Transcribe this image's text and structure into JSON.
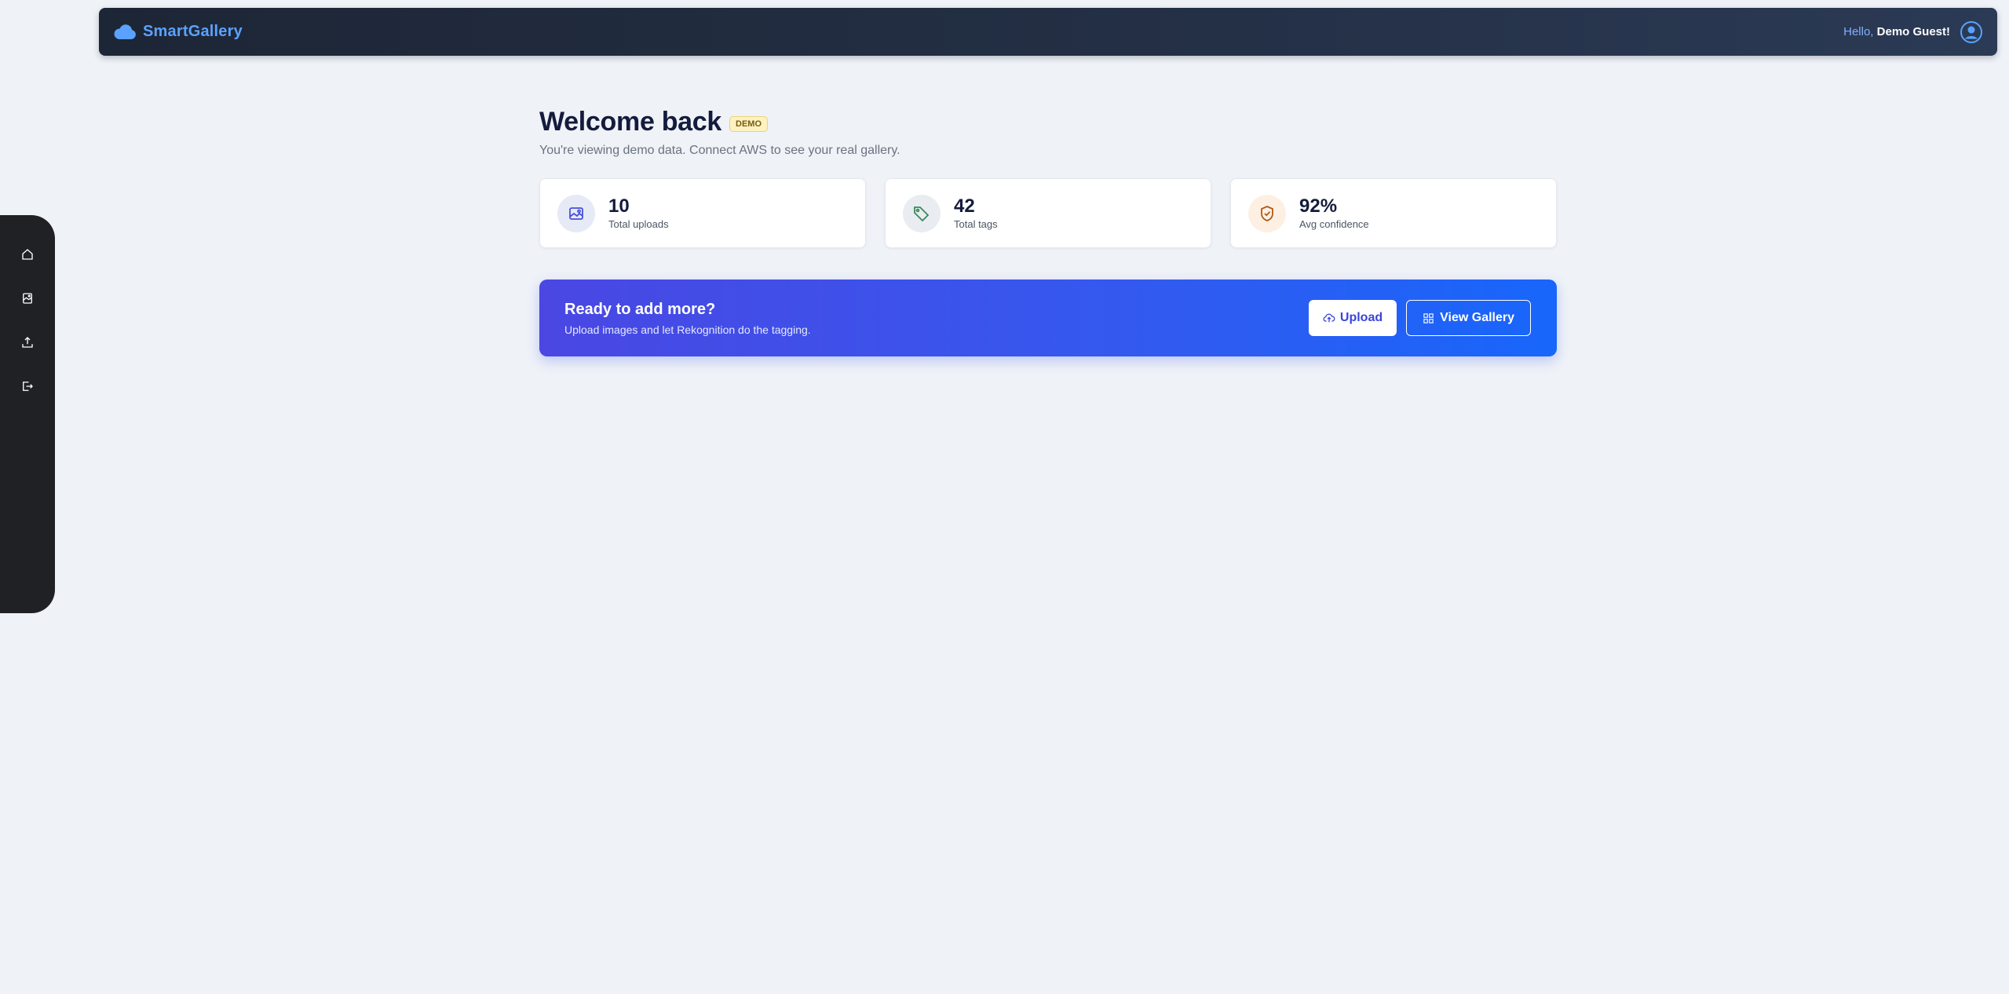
{
  "navbar": {
    "brand_name": "SmartGallery",
    "brand_icon": "cloud-icon",
    "greeting_prefix": "Hello, ",
    "user_name": "Demo Guest",
    "greeting_suffix": "!",
    "avatar_icon": "user-circle-icon"
  },
  "sidebar": {
    "items": [
      {
        "name": "home",
        "icon": "home-icon"
      },
      {
        "name": "gallery",
        "icon": "image-icon"
      },
      {
        "name": "upload",
        "icon": "upload-icon"
      },
      {
        "name": "logout",
        "icon": "logout-icon"
      }
    ]
  },
  "main": {
    "title": "Welcome back",
    "badge": "DEMO",
    "subtitle": "You're viewing demo data. Connect AWS to see your real gallery."
  },
  "stats": [
    {
      "value": "10",
      "label": "Total uploads",
      "icon": "image-icon",
      "color": "#4a50d8"
    },
    {
      "value": "42",
      "label": "Total tags",
      "icon": "tag-icon",
      "color": "#3a8b5a"
    },
    {
      "value": "92%",
      "label": "Avg confidence",
      "icon": "shield-check-icon",
      "color": "#b15a16"
    }
  ],
  "cta": {
    "title": "Ready to add more?",
    "subtitle": "Upload images and let Rekognition do the tagging.",
    "upload_label": "Upload",
    "gallery_label": "View Gallery"
  },
  "colors": {
    "accent": "#5aa2ff",
    "cta_start": "#4a47e3",
    "cta_end": "#1866fb",
    "background": "#eff2f7"
  }
}
